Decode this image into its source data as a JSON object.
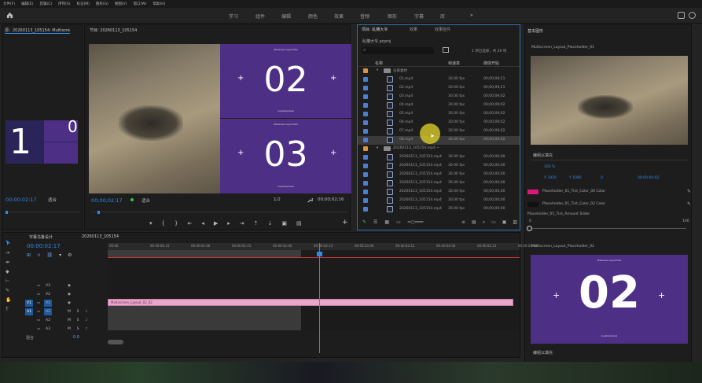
{
  "menu": [
    "文件(F)",
    "编辑(E)",
    "剪辑(C)",
    "序列(S)",
    "标记(M)",
    "图形(G)",
    "视图(V)",
    "窗口(W)",
    "帮助(H)"
  ],
  "workspaces": [
    "学习",
    "组件",
    "编辑",
    "颜色",
    "效果",
    "音频",
    "图形",
    "字幕",
    "库"
  ],
  "source": {
    "tab": "源：20260113_105154: Multiscre",
    "timecode": "00;00;02;17",
    "fit": "适合",
    "big_digit": "1",
    "small_digit": "0"
  },
  "program": {
    "tab": "节目: 20260113_105154",
    "timecode": "00;00;02;17",
    "fit": "适合",
    "ratio": "1/2",
    "duration": "00;00;02;16",
    "num1": "02",
    "num2": "03",
    "header_text": "Multiscreen Layout Field",
    "footer_text": "anywhere/visual"
  },
  "project": {
    "tabs": [
      "项目: 乱糟大爷",
      "效果",
      "效果控件"
    ],
    "file": "乱糟大爷.prproj",
    "search": "",
    "selected": "1 项已选择，共 29 项",
    "col_name": "名称",
    "col_fps": "帧速率",
    "col_start": "媒体开始",
    "rows": [
      {
        "name": "分屏素材",
        "fps": "",
        "start": "",
        "folder": true,
        "color": "#e0953a",
        "indent": 0
      },
      {
        "name": "01.mp4",
        "fps": "30.00 fps",
        "start": "00;00;09;21",
        "indent": 1
      },
      {
        "name": "02.mp4",
        "fps": "30.00 fps",
        "start": "00;00;09;21",
        "indent": 1
      },
      {
        "name": "03.mp4",
        "fps": "30.00 fps",
        "start": "00;00;09;02",
        "indent": 1
      },
      {
        "name": "04.mp4",
        "fps": "30.00 fps",
        "start": "00;00;09;02",
        "indent": 1
      },
      {
        "name": "05.mp4",
        "fps": "30.00 fps",
        "start": "00;00;09;02",
        "indent": 1
      },
      {
        "name": "06.mp4",
        "fps": "30.00 fps",
        "start": "00;00;09;02",
        "indent": 1
      },
      {
        "name": "07.mp4",
        "fps": "30.00 fps",
        "start": "00;00;09;02",
        "indent": 1
      },
      {
        "name": "08.mp4",
        "fps": "30.00 fps",
        "start": "00;00;09;02",
        "indent": 1,
        "selected": true
      },
      {
        "name": "20260113_105154.mp4 ~",
        "fps": "",
        "start": "",
        "folder": true,
        "color": "#e0953a",
        "indent": 0
      },
      {
        "name": "20260113_105154.mp4",
        "fps": "30.00 fps",
        "start": "00;00;00;00",
        "indent": 1
      },
      {
        "name": "20260113_105154.mp4",
        "fps": "30.00 fps",
        "start": "00;00;00;00",
        "indent": 1
      },
      {
        "name": "20260113_105154.mp4",
        "fps": "30.00 fps",
        "start": "00;00;00;00",
        "indent": 1
      },
      {
        "name": "20260113_105154.mp4",
        "fps": "30.00 fps",
        "start": "00;00;00;00",
        "indent": 1
      },
      {
        "name": "20260113_105154.mp4",
        "fps": "30.00 fps",
        "start": "00;00;00;00",
        "indent": 1
      },
      {
        "name": "20260113_105154.mp4",
        "fps": "30.00 fps",
        "start": "00;00;00;00",
        "indent": 1
      },
      {
        "name": "20260113_105154.mp4",
        "fps": "30.00 fps",
        "start": "00;00;00;00",
        "indent": 1
      }
    ]
  },
  "essential": {
    "tab": "基本图形",
    "layer1": "Multiscreen_Layout_Placeholder_01",
    "align_fill": "编组以填充",
    "pos_x": "X 1920",
    "pos_y": "Y 1080",
    "scale": "100 %",
    "rot": "0",
    "time": "00:00:00:02",
    "color1_label": "Placeholder_01_Tint_Color_00 Color",
    "color2_label": "Placeholder_01_Tint_Color_02 Color",
    "slider_label": "Placeholder_01_Tint_Amount Slider",
    "slider_min": "0",
    "slider_max": "100",
    "slider_value": 0,
    "color1": "#e0177a",
    "color2": "#111111",
    "layer2": "Multiscreen_Layout_Placeholder_02",
    "big_num": "02",
    "align_fill2": "编组以填充"
  },
  "timeline": {
    "tab": "字幕乌鲁设计",
    "seq": "20260113_105154",
    "timecode": "00:00:02:17",
    "ruler": [
      "00:00",
      "00:00:00:15",
      "00:00:01:00",
      "00:00:01:15",
      "00:00:02:00",
      "00:00:02:15",
      "00:00:03:00",
      "00:00:03:15",
      "00:00:04:00",
      "00:00:04:15",
      "00:00:05:00"
    ],
    "tracks": [
      "V3",
      "V2",
      "V1",
      "A1",
      "A2",
      "A3"
    ],
    "master": "混合",
    "master_val": "0.0",
    "clip": "Multiscreen_Layout_02_02"
  }
}
